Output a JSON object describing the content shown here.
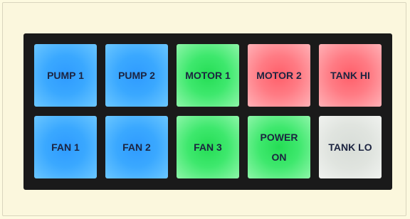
{
  "pads": [
    {
      "label": "PUMP 1",
      "color": "blue"
    },
    {
      "label": "PUMP 2",
      "color": "blue"
    },
    {
      "label": "MOTOR 1",
      "color": "green"
    },
    {
      "label": "MOTOR 2",
      "color": "red"
    },
    {
      "label": "TANK HI",
      "color": "red"
    },
    {
      "label": "FAN 1",
      "color": "blue"
    },
    {
      "label": "FAN 2",
      "color": "blue"
    },
    {
      "label": "FAN 3",
      "color": "green"
    },
    {
      "label": "POWER\nON",
      "color": "green"
    },
    {
      "label": "TANK LO",
      "color": "white"
    }
  ],
  "colors": {
    "blue": "#3aa8ff",
    "green": "#3ee86d",
    "red": "#ff7b84",
    "white": "#e0e4df",
    "panel": "#1a1a1a",
    "background": "#fdfae0"
  }
}
